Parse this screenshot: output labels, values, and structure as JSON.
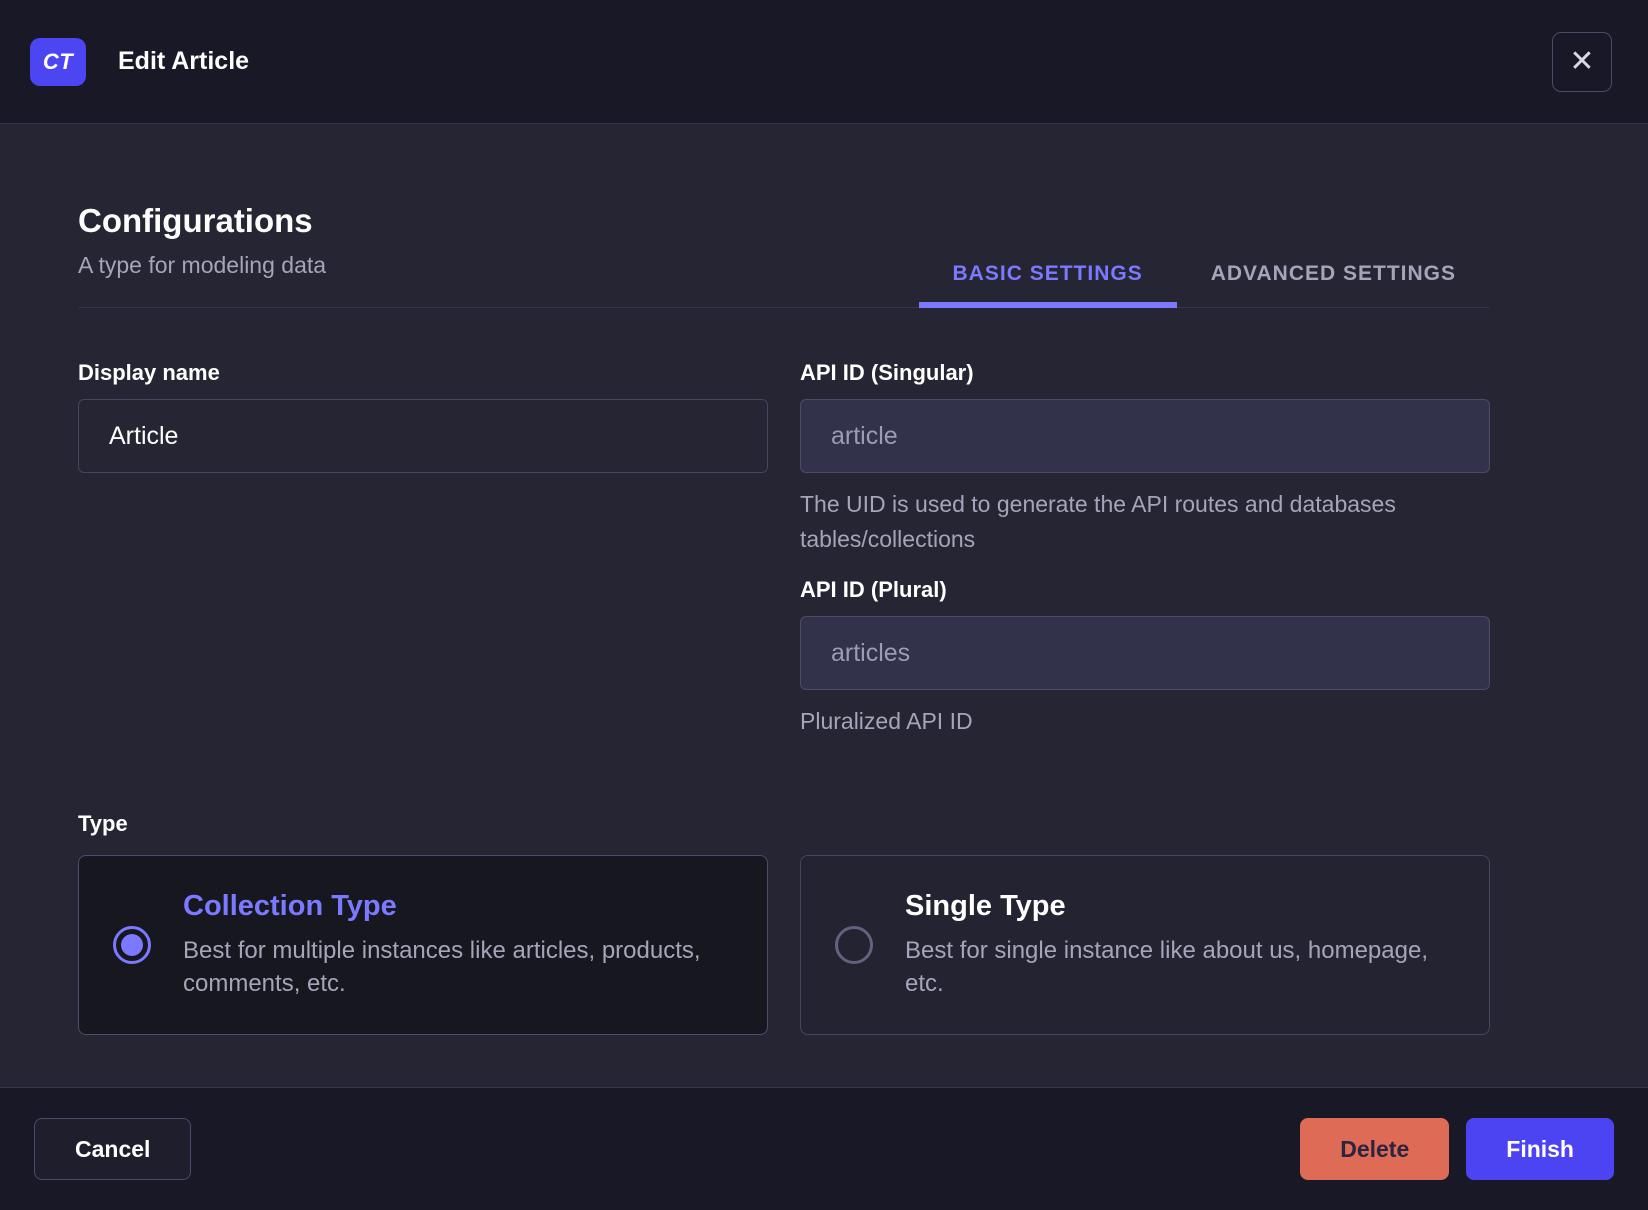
{
  "header": {
    "badge": "CT",
    "title": "Edit Article",
    "close_icon": "✕"
  },
  "intro": {
    "title": "Configurations",
    "subtitle": "A type for modeling data",
    "tabs": [
      {
        "label": "BASIC SETTINGS",
        "active": true
      },
      {
        "label": "ADVANCED SETTINGS",
        "active": false
      }
    ]
  },
  "form": {
    "display_name": {
      "label": "Display name",
      "value": "Article"
    },
    "api_id_singular": {
      "label": "API ID (Singular)",
      "value": "article",
      "hint": "The UID is used to generate the API routes and databases tables/collections"
    },
    "api_id_plural": {
      "label": "API ID (Plural)",
      "value": "articles",
      "hint": "Pluralized API ID"
    },
    "type": {
      "label": "Type",
      "options": [
        {
          "title": "Collection Type",
          "description": "Best for multiple instances like articles, products, comments, etc.",
          "selected": true
        },
        {
          "title": "Single Type",
          "description": "Best for single instance like about us, homepage, etc.",
          "selected": false
        }
      ]
    }
  },
  "footer": {
    "cancel_label": "Cancel",
    "delete_label": "Delete",
    "finish_label": "Finish"
  },
  "colors": {
    "primary": "#4c44f2",
    "accent_text": "#7b79ff",
    "danger": "#dd6b55",
    "header_bg": "#181826",
    "body_bg": "#252533"
  }
}
